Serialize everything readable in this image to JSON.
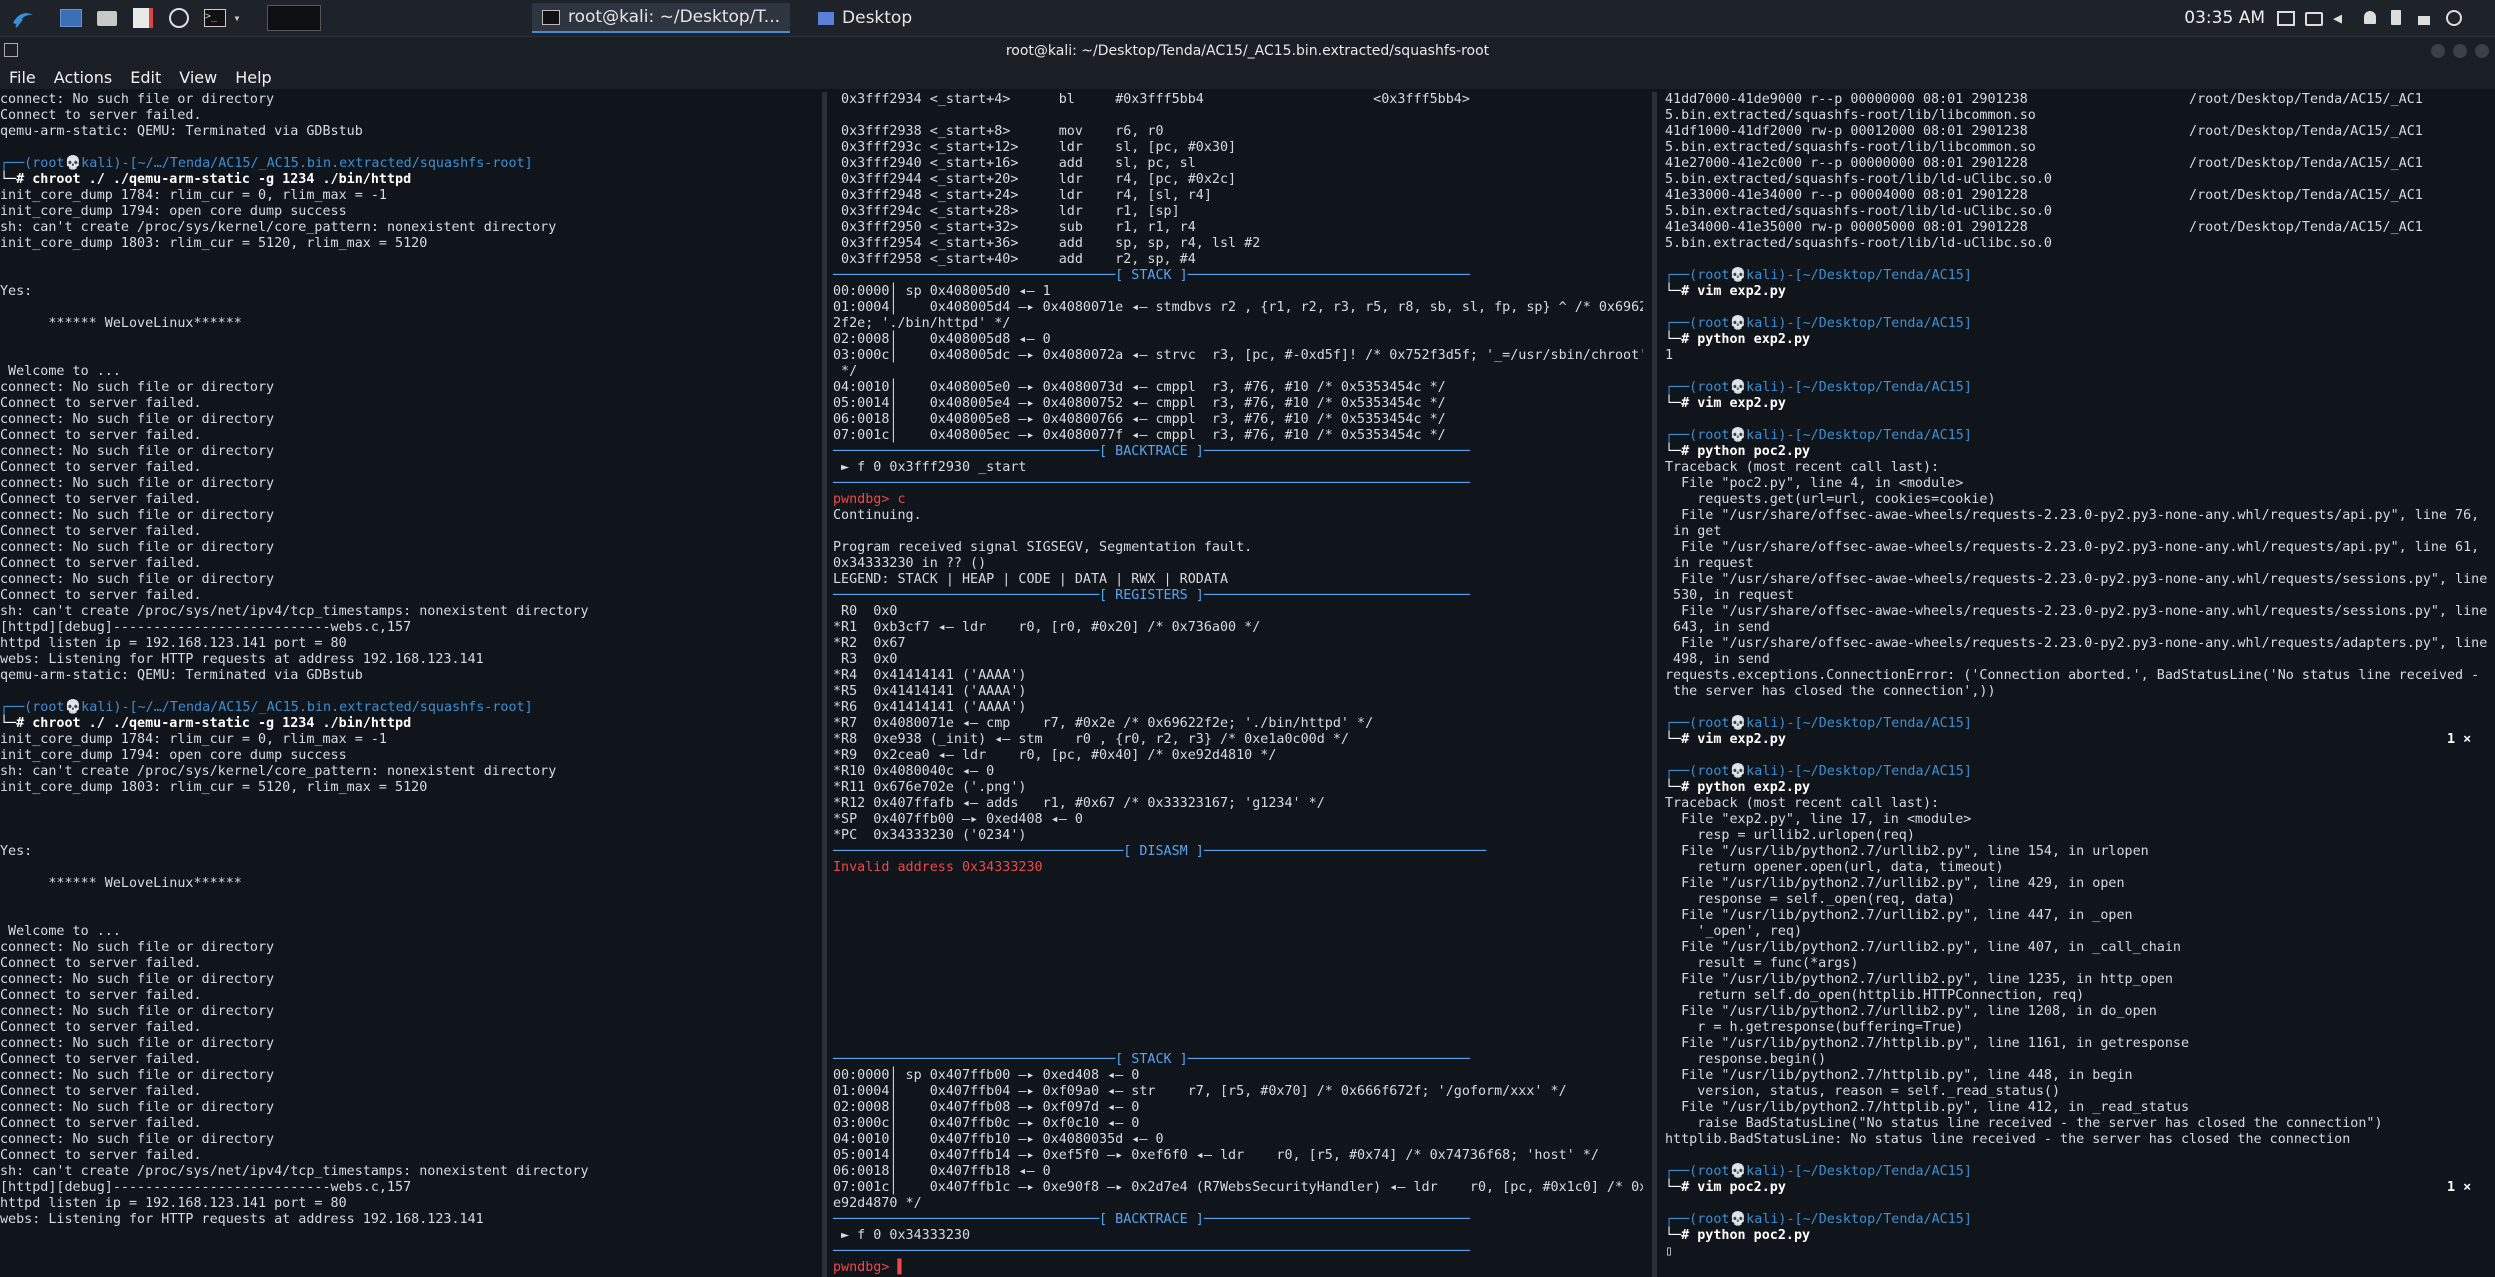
{
  "taskbar": {
    "apps": [
      {
        "name": "kali-menu"
      },
      {
        "name": "workspace"
      },
      {
        "name": "file-manager"
      },
      {
        "name": "text-editor"
      },
      {
        "name": "browser"
      },
      {
        "name": "terminal"
      }
    ],
    "windows": [
      {
        "label": "root@kali: ~/Desktop/T..."
      },
      {
        "label": "Desktop"
      }
    ],
    "clock": "03:35 AM"
  },
  "window": {
    "title": "root@kali: ~/Desktop/Tenda/AC15/_AC15.bin.extracted/squashfs-root"
  },
  "menu": [
    "File",
    "Actions",
    "Edit",
    "View",
    "Help"
  ],
  "left_lines": [
    "connect: No such file or directory",
    "Connect to server failed.",
    "qemu-arm-static: QEMU: Terminated via GDBstub",
    "",
    "┌──(root💀kali)-[~/…/Tenda/AC15/_AC15.bin.extracted/squashfs-root]",
    "└─# chroot ./ ./qemu-arm-static -g 1234 ./bin/httpd",
    "init_core_dump 1784: rlim_cur = 0, rlim_max = -1",
    "init_core_dump 1794: open core dump success",
    "sh: can't create /proc/sys/kernel/core_pattern: nonexistent directory",
    "init_core_dump 1803: rlim_cur = 5120, rlim_max = 5120",
    "",
    "",
    "Yes:",
    "",
    "      ****** WeLoveLinux******",
    "",
    "",
    " Welcome to ...",
    "connect: No such file or directory",
    "Connect to server failed.",
    "connect: No such file or directory",
    "Connect to server failed.",
    "connect: No such file or directory",
    "Connect to server failed.",
    "connect: No such file or directory",
    "Connect to server failed.",
    "connect: No such file or directory",
    "Connect to server failed.",
    "connect: No such file or directory",
    "Connect to server failed.",
    "connect: No such file or directory",
    "Connect to server failed.",
    "sh: can't create /proc/sys/net/ipv4/tcp_timestamps: nonexistent directory",
    "[httpd][debug]---------------------------webs.c,157",
    "httpd listen ip = 192.168.123.141 port = 80",
    "webs: Listening for HTTP requests at address 192.168.123.141",
    "qemu-arm-static: QEMU: Terminated via GDBstub",
    "",
    "┌──(root💀kali)-[~/…/Tenda/AC15/_AC15.bin.extracted/squashfs-root]",
    "└─# chroot ./ ./qemu-arm-static -g 1234 ./bin/httpd",
    "init_core_dump 1784: rlim_cur = 0, rlim_max = -1",
    "init_core_dump 1794: open core dump success",
    "sh: can't create /proc/sys/kernel/core_pattern: nonexistent directory",
    "init_core_dump 1803: rlim_cur = 5120, rlim_max = 5120",
    "",
    "",
    "",
    "Yes:",
    "",
    "      ****** WeLoveLinux******",
    "",
    "",
    " Welcome to ...",
    "connect: No such file or directory",
    "Connect to server failed.",
    "connect: No such file or directory",
    "Connect to server failed.",
    "connect: No such file or directory",
    "Connect to server failed.",
    "connect: No such file or directory",
    "Connect to server failed.",
    "connect: No such file or directory",
    "Connect to server failed.",
    "connect: No such file or directory",
    "Connect to server failed.",
    "connect: No such file or directory",
    "Connect to server failed.",
    "sh: can't create /proc/sys/net/ipv4/tcp_timestamps: nonexistent directory",
    "[httpd][debug]---------------------------webs.c,157",
    "httpd listen ip = 192.168.123.141 port = 80",
    "webs: Listening for HTTP requests at address 192.168.123.141",
    ""
  ],
  "mid_lines": [
    " 0x3fff2934 <_start+4>      bl     #0x3fff5bb4                     <0x3fff5bb4>",
    "",
    " 0x3fff2938 <_start+8>      mov    r6, r0",
    " 0x3fff293c <_start+12>     ldr    sl, [pc, #0x30]",
    " 0x3fff2940 <_start+16>     add    sl, pc, sl",
    " 0x3fff2944 <_start+20>     ldr    r4, [pc, #0x2c]",
    " 0x3fff2948 <_start+24>     ldr    r4, [sl, r4]",
    " 0x3fff294c <_start+28>     ldr    r1, [sp]",
    " 0x3fff2950 <_start+32>     sub    r1, r1, r4",
    " 0x3fff2954 <_start+36>     add    sp, sp, r4, lsl #2",
    " 0x3fff2958 <_start+40>     add    r2, sp, #4",
    "───────────────────────────────────[ STACK ]───────────────────────────────────",
    "00:0000│ sp 0x408005d0 ◂— 1",
    "01:0004│    0x408005d4 —▸ 0x4080071e ◂— stmdbvs r2 , {r1, r2, r3, r5, r8, sb, sl, fp, sp} ^ /* 0x6962",
    "2f2e; './bin/httpd' */",
    "02:0008│    0x408005d8 ◂— 0",
    "03:000c│    0x408005dc —▸ 0x4080072a ◂— strvc  r3, [pc, #-0xd5f]! /* 0x752f3d5f; '_=/usr/sbin/chroot'",
    " */",
    "04:0010│    0x408005e0 —▸ 0x4080073d ◂— cmppl  r3, #76, #10 /* 0x5353454c */",
    "05:0014│    0x408005e4 —▸ 0x40800752 ◂— cmppl  r3, #76, #10 /* 0x5353454c */",
    "06:0018│    0x408005e8 —▸ 0x40800766 ◂— cmppl  r3, #76, #10 /* 0x5353454c */",
    "07:001c│    0x408005ec —▸ 0x4080077f ◂— cmppl  r3, #76, #10 /* 0x5353454c */",
    "─────────────────────────────────[ BACKTRACE ]─────────────────────────────────",
    " ► f 0 0x3fff2930 _start",
    "───────────────────────────────────────────────────────────────────────────────",
    "pwndbg> c",
    "Continuing.",
    "",
    "Program received signal SIGSEGV, Segmentation fault.",
    "0x34333230 in ?? ()",
    "LEGEND: STACK | HEAP | CODE | DATA | RWX | RODATA",
    "─────────────────────────────────[ REGISTERS ]─────────────────────────────────",
    " R0  0x0",
    "*R1  0xb3cf7 ◂— ldr    r0, [r0, #0x20] /* 0x736a00 */",
    "*R2  0x67",
    " R3  0x0",
    "*R4  0x41414141 ('AAAA')",
    "*R5  0x41414141 ('AAAA')",
    "*R6  0x41414141 ('AAAA')",
    "*R7  0x4080071e ◂— cmp    r7, #0x2e /* 0x69622f2e; './bin/httpd' */",
    "*R8  0xe938 (_init) ◂— stm    r0 , {r0, r2, r3} /* 0xe1a0c00d */",
    "*R9  0x2cea0 ◂— ldr    r0, [pc, #0x40] /* 0xe92d4810 */",
    "*R10 0x4080040c ◂— 0",
    "*R11 0x676e702e ('.png')",
    "*R12 0x407ffafb ◂— adds   r1, #0x67 /* 0x33323167; 'g1234' */",
    "*SP  0x407ffb00 —▸ 0xed408 ◂— 0",
    "*PC  0x34333230 ('0234')",
    "────────────────────────────────────[ DISASM ]───────────────────────────────────",
    "Invalid address 0x34333230",
    "",
    "",
    "",
    "",
    "",
    "",
    "",
    "",
    "",
    "",
    "",
    "───────────────────────────────────[ STACK ]───────────────────────────────────",
    "00:0000│ sp 0x407ffb00 —▸ 0xed408 ◂— 0",
    "01:0004│    0x407ffb04 —▸ 0xf09a0 ◂— str    r7, [r5, #0x70] /* 0x666f672f; '/goform/xxx' */",
    "02:0008│    0x407ffb08 —▸ 0xf097d ◂— 0",
    "03:000c│    0x407ffb0c —▸ 0xf0c10 ◂— 0",
    "04:0010│    0x407ffb10 —▸ 0x4080035d ◂— 0",
    "05:0014│    0x407ffb14 —▸ 0xef5f0 —▸ 0xef6f0 ◂— ldr    r0, [r5, #0x74] /* 0x74736f68; 'host' */",
    "06:0018│    0x407ffb18 ◂— 0",
    "07:001c│    0x407ffb1c —▸ 0xe90f8 —▸ 0x2d7e4 (R7WebsSecurityHandler) ◂— ldr    r0, [pc, #0x1c0] /* 0x",
    "e92d4870 */",
    "─────────────────────────────────[ BACKTRACE ]─────────────────────────────────",
    " ► f 0 0x34333230",
    "───────────────────────────────────────────────────────────────────────────────",
    "pwndbg> ▌"
  ],
  "right_lines": [
    "41dd7000-41de9000 r--p 00000000 08:01 2901238                    /root/Desktop/Tenda/AC15/_AC1",
    "5.bin.extracted/squashfs-root/lib/libcommon.so",
    "41df1000-41df2000 rw-p 00012000 08:01 2901238                    /root/Desktop/Tenda/AC15/_AC1",
    "5.bin.extracted/squashfs-root/lib/libcommon.so",
    "41e27000-41e2c000 r--p 00000000 08:01 2901228                    /root/Desktop/Tenda/AC15/_AC1",
    "5.bin.extracted/squashfs-root/lib/ld-uClibc.so.0",
    "41e33000-41e34000 r--p 00004000 08:01 2901228                    /root/Desktop/Tenda/AC15/_AC1",
    "5.bin.extracted/squashfs-root/lib/ld-uClibc.so.0",
    "41e34000-41e35000 rw-p 00005000 08:01 2901228                    /root/Desktop/Tenda/AC15/_AC1",
    "5.bin.extracted/squashfs-root/lib/ld-uClibc.so.0",
    "",
    "┌──(root💀kali)-[~/Desktop/Tenda/AC15]",
    "└─# vim exp2.py",
    "",
    "┌──(root💀kali)-[~/Desktop/Tenda/AC15]",
    "└─# python exp2.py",
    "1",
    "",
    "┌──(root💀kali)-[~/Desktop/Tenda/AC15]",
    "└─# vim exp2.py",
    "",
    "┌──(root💀kali)-[~/Desktop/Tenda/AC15]",
    "└─# python poc2.py",
    "Traceback (most recent call last):",
    "  File \"poc2.py\", line 4, in <module>",
    "    requests.get(url=url, cookies=cookie)",
    "  File \"/usr/share/offsec-awae-wheels/requests-2.23.0-py2.py3-none-any.whl/requests/api.py\", line 76,",
    " in get",
    "  File \"/usr/share/offsec-awae-wheels/requests-2.23.0-py2.py3-none-any.whl/requests/api.py\", line 61,",
    " in request",
    "  File \"/usr/share/offsec-awae-wheels/requests-2.23.0-py2.py3-none-any.whl/requests/sessions.py\", line",
    " 530, in request",
    "  File \"/usr/share/offsec-awae-wheels/requests-2.23.0-py2.py3-none-any.whl/requests/sessions.py\", line",
    " 643, in send",
    "  File \"/usr/share/offsec-awae-wheels/requests-2.23.0-py2.py3-none-any.whl/requests/adapters.py\", line",
    " 498, in send",
    "requests.exceptions.ConnectionError: ('Connection aborted.', BadStatusLine('No status line received -",
    " the server has closed the connection',))",
    "",
    "┌──(root💀kali)-[~/Desktop/Tenda/AC15]",
    "└─# vim exp2.py                                                                                  1 ⨯",
    "",
    "┌──(root💀kali)-[~/Desktop/Tenda/AC15]",
    "└─# python exp2.py",
    "Traceback (most recent call last):",
    "  File \"exp2.py\", line 17, in <module>",
    "    resp = urllib2.urlopen(req)",
    "  File \"/usr/lib/python2.7/urllib2.py\", line 154, in urlopen",
    "    return opener.open(url, data, timeout)",
    "  File \"/usr/lib/python2.7/urllib2.py\", line 429, in open",
    "    response = self._open(req, data)",
    "  File \"/usr/lib/python2.7/urllib2.py\", line 447, in _open",
    "    '_open', req)",
    "  File \"/usr/lib/python2.7/urllib2.py\", line 407, in _call_chain",
    "    result = func(*args)",
    "  File \"/usr/lib/python2.7/urllib2.py\", line 1235, in http_open",
    "    return self.do_open(httplib.HTTPConnection, req)",
    "  File \"/usr/lib/python2.7/urllib2.py\", line 1208, in do_open",
    "    r = h.getresponse(buffering=True)",
    "  File \"/usr/lib/python2.7/httplib.py\", line 1161, in getresponse",
    "    response.begin()",
    "  File \"/usr/lib/python2.7/httplib.py\", line 448, in begin",
    "    version, status, reason = self._read_status()",
    "  File \"/usr/lib/python2.7/httplib.py\", line 412, in _read_status",
    "    raise BadStatusLine(\"No status line received - the server has closed the connection\")",
    "httplib.BadStatusLine: No status line received - the server has closed the connection",
    "",
    "┌──(root💀kali)-[~/Desktop/Tenda/AC15]",
    "└─# vim poc2.py                                                                                  1 ⨯",
    "",
    "┌──(root💀kali)-[~/Desktop/Tenda/AC15]",
    "└─# python poc2.py",
    "▯"
  ]
}
